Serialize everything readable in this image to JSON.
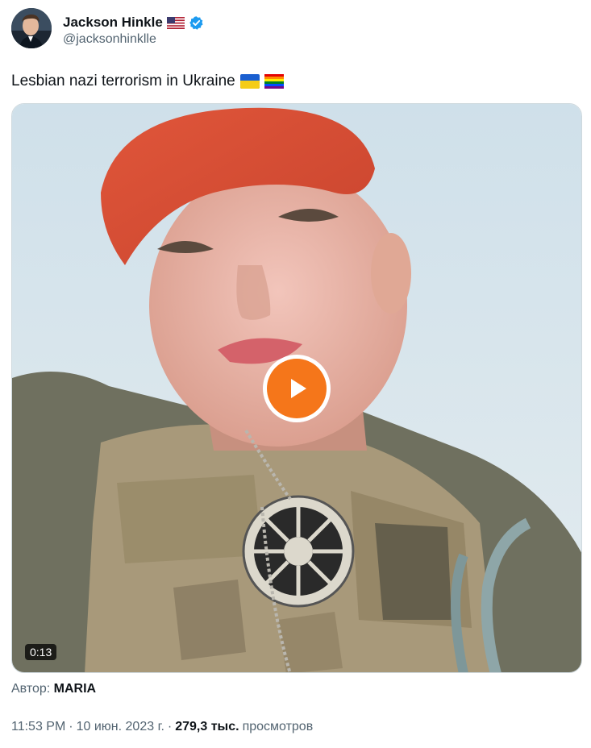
{
  "user": {
    "display_name": "Jackson Hinkle",
    "handle": "@jacksonhinklle",
    "flag_icon": "us-flag-icon",
    "verified_icon": "verified-badge-icon",
    "verified_color": "#1d9bf0"
  },
  "tweet": {
    "text": "Lesbian nazi terrorism in Ukraine",
    "emojis": [
      "ukraine-flag-emoji",
      "rainbow-flag-emoji"
    ]
  },
  "media": {
    "type": "video",
    "duration": "0:13",
    "play_button_color": "#f5761a"
  },
  "author_line": {
    "label": "Автор:",
    "name": "MARIA"
  },
  "meta": {
    "time": "11:53 PM",
    "separator": "·",
    "date": "10 июн. 2023 г.",
    "views_count": "279,3 тыс.",
    "views_label": "просмотров"
  },
  "colors": {
    "secondary_text": "#536471",
    "primary_text": "#0f1419"
  }
}
